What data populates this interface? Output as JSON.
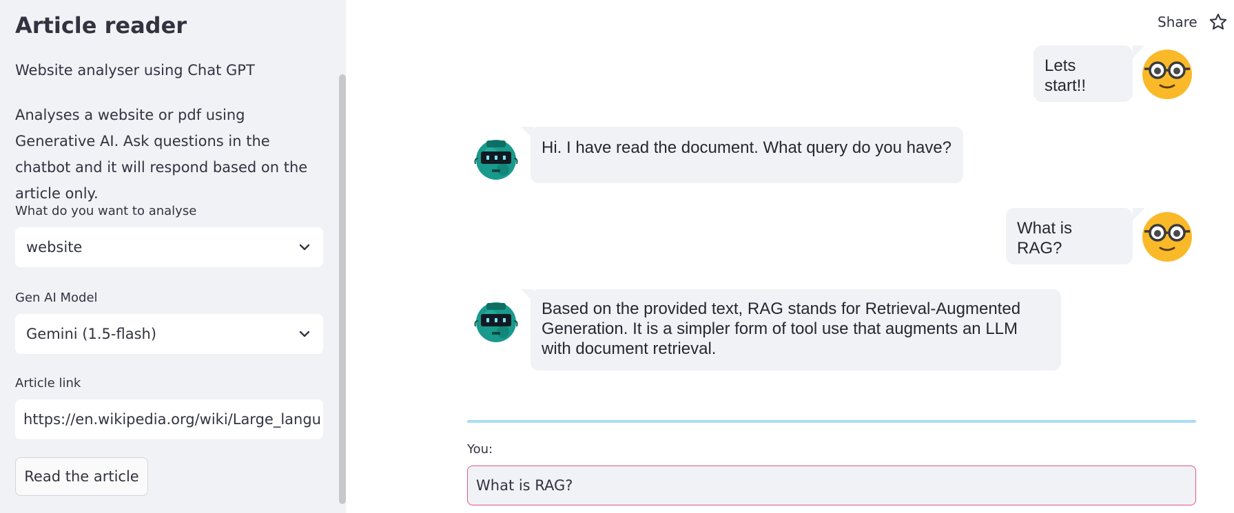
{
  "sidebar": {
    "title": "Article reader",
    "subtitle": "Website analyser using Chat GPT",
    "description": "Analyses a website or pdf using Generative AI. Ask questions in the chatbot and it will respond based on the article only.",
    "analyse_label": "What do you want to analyse",
    "analyse_value": "website",
    "model_label": "Gen AI Model",
    "model_value": "Gemini (1.5-flash)",
    "link_label": "Article link",
    "link_value": "https://en.wikipedia.org/wiki/Large_langu",
    "button_label": "Read the article"
  },
  "header": {
    "share_label": "Share",
    "star_icon": "star-icon"
  },
  "chat": {
    "messages": [
      {
        "role": "user",
        "text": "Lets start!!"
      },
      {
        "role": "bot",
        "text": "Hi. I have read the document. What query do you have?"
      },
      {
        "role": "user",
        "text": "What is RAG?"
      },
      {
        "role": "bot",
        "text": "Based on the provided text, RAG stands for Retrieval-Augmented Generation. It is a simpler form of tool use that augments an LLM with document retrieval."
      }
    ],
    "input_label": "You:",
    "input_value": "What is RAG?"
  },
  "colors": {
    "sidebar_bg": "#f0f2f6",
    "divider": "#a9dcf2",
    "input_border": "#e0577c",
    "user_avatar": "#f9b928",
    "bot_avatar": "#1a9a8c"
  }
}
